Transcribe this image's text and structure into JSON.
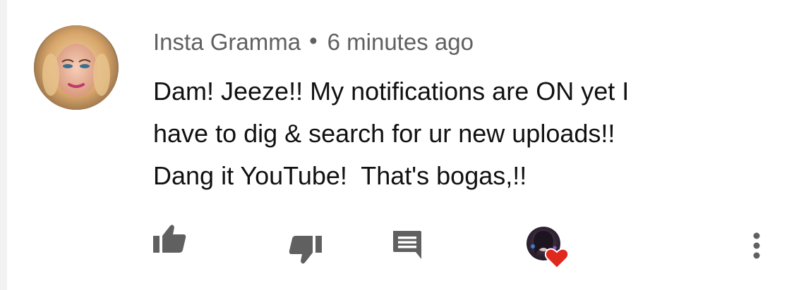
{
  "comment": {
    "author": "Insta Gramma",
    "separator": "•",
    "time": "6 minutes ago",
    "text_lines": [
      "Dam! Jeeze!! My notifications are ON yet I",
      "have to dig & search for ur new uploads!!",
      "Dang it YouTube!  That's bogas,!!"
    ]
  },
  "actions": {
    "like_icon": "thumb-up-icon",
    "dislike_icon": "thumb-down-icon",
    "reply_icon": "comment-icon",
    "creator_heart_icon": "creator-heart-icon",
    "more_icon": "more-vertical-icon"
  },
  "colors": {
    "text": "#111111",
    "meta": "#606060",
    "icon": "#606060",
    "heart": "#e0281f"
  }
}
